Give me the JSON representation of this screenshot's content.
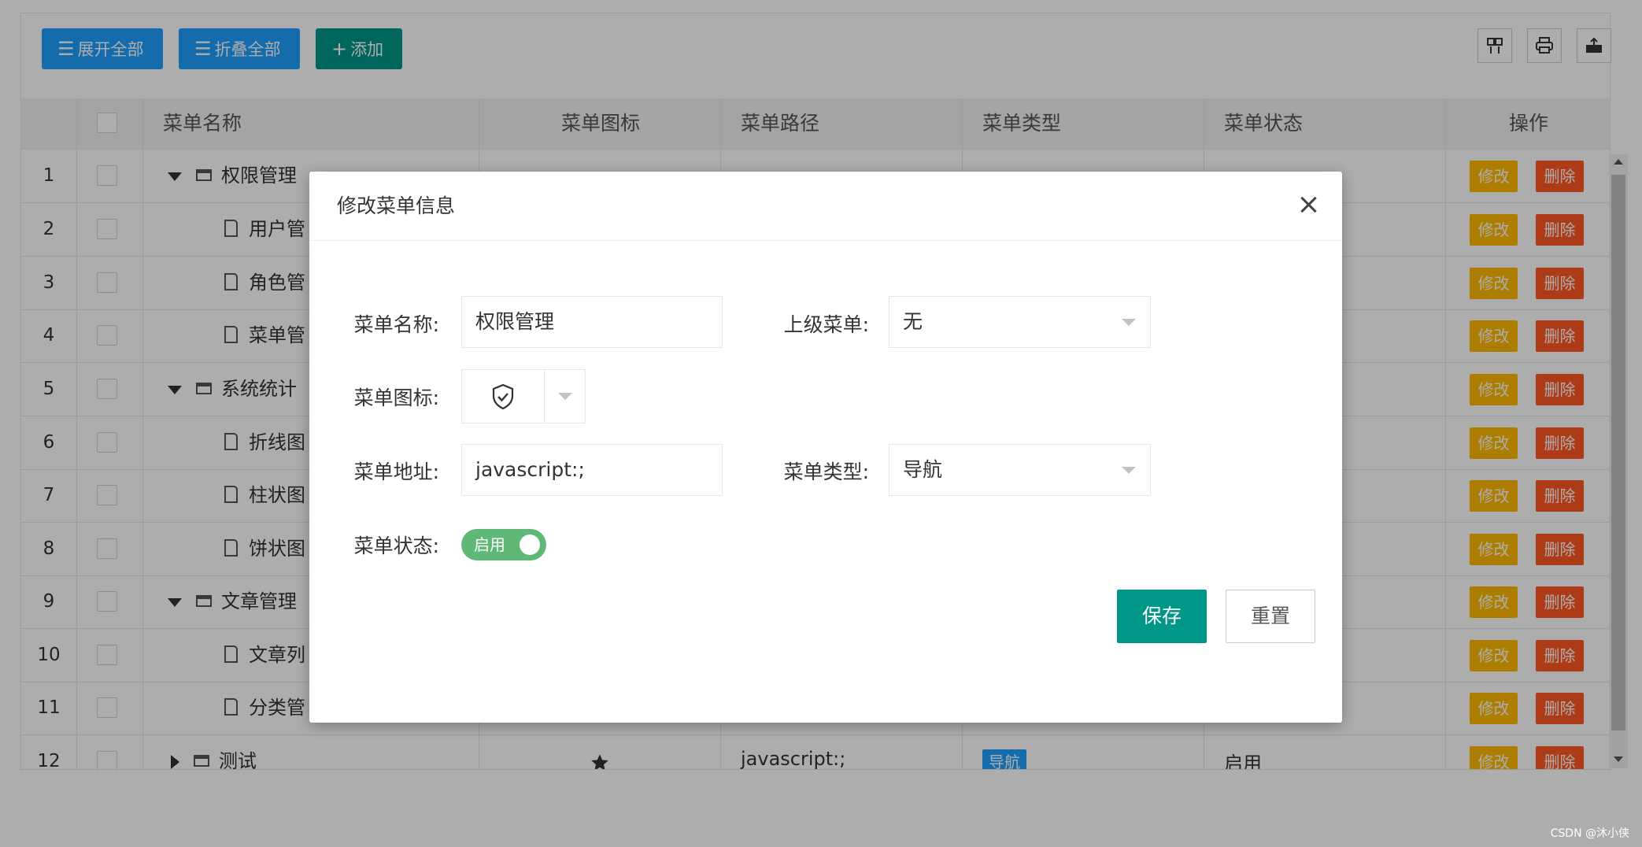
{
  "toolbar": {
    "expand_all": "展开全部",
    "collapse_all": "折叠全部",
    "add": "添加",
    "right_icons": [
      "columns-icon",
      "print-icon",
      "export-icon"
    ]
  },
  "table": {
    "headers": {
      "name": "菜单名称",
      "icon": "菜单图标",
      "path": "菜单路径",
      "type": "菜单类型",
      "status": "菜单状态",
      "ops": "操作"
    },
    "rows": [
      {
        "num": "1",
        "name": "权限管理",
        "kind": "folder",
        "expanded": true
      },
      {
        "num": "2",
        "name": "用户管",
        "kind": "file"
      },
      {
        "num": "3",
        "name": "角色管",
        "kind": "file"
      },
      {
        "num": "4",
        "name": "菜单管",
        "kind": "file"
      },
      {
        "num": "5",
        "name": "系统统计",
        "kind": "folder",
        "expanded": true
      },
      {
        "num": "6",
        "name": "折线图",
        "kind": "file"
      },
      {
        "num": "7",
        "name": "柱状图",
        "kind": "file"
      },
      {
        "num": "8",
        "name": "饼状图",
        "kind": "file"
      },
      {
        "num": "9",
        "name": "文章管理",
        "kind": "folder",
        "expanded": true
      },
      {
        "num": "10",
        "name": "文章列",
        "kind": "file"
      },
      {
        "num": "11",
        "name": "分类管",
        "kind": "file"
      },
      {
        "num": "12",
        "name": "测试",
        "kind": "folder",
        "expanded": false,
        "icon": "star-icon",
        "path": "javascript:;",
        "type": "导航",
        "status": "启用"
      }
    ],
    "edit_label": "修改",
    "delete_label": "删除"
  },
  "modal": {
    "title": "修改菜单信息",
    "fields": {
      "name_label": "菜单名称:",
      "name_value": "权限管理",
      "parent_label": "上级菜单:",
      "parent_value": "无",
      "icon_label": "菜单图标:",
      "icon_value": "shield-check-icon",
      "url_label": "菜单地址:",
      "url_value": "javascript:;",
      "type_label": "菜单类型:",
      "type_value": "导航",
      "status_label": "菜单状态:",
      "status_value": "启用"
    },
    "save": "保存",
    "reset": "重置"
  },
  "watermark": "CSDN @沐小侠",
  "colors": {
    "blue": "#1E9FFF",
    "green": "#009688",
    "orange": "#FFB800",
    "red": "#FF5722",
    "switch_on": "#5FB878"
  }
}
